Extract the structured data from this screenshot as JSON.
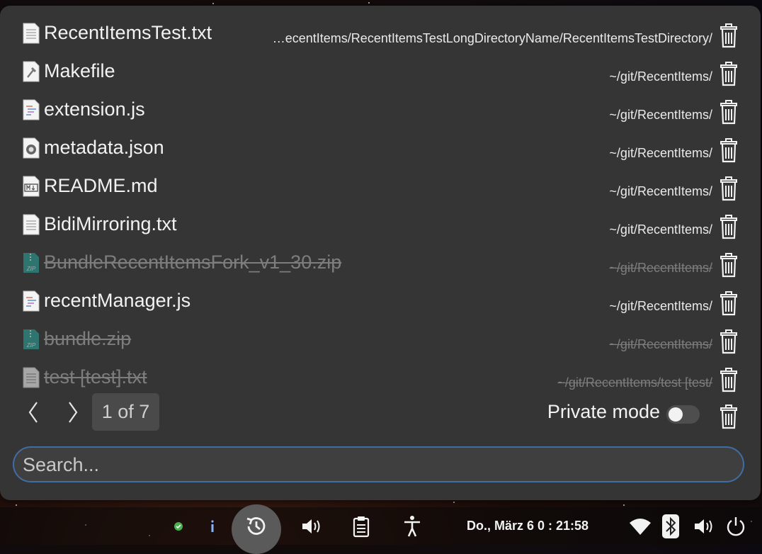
{
  "recent_items": [
    {
      "name": "RecentItemsTest.txt",
      "path": "…ecentItems/RecentItemsTestLongDirectoryName/RecentItemsTestDirectory/",
      "icon": "text-file-icon",
      "missing": false
    },
    {
      "name": "Makefile",
      "path": "~/git/RecentItems/",
      "icon": "makefile-icon",
      "missing": false
    },
    {
      "name": "extension.js",
      "path": "~/git/RecentItems/",
      "icon": "script-file-icon",
      "missing": false
    },
    {
      "name": "metadata.json",
      "path": "~/git/RecentItems/",
      "icon": "json-file-icon",
      "missing": false
    },
    {
      "name": "README.md",
      "path": "~/git/RecentItems/",
      "icon": "markdown-file-icon",
      "missing": false
    },
    {
      "name": "BidiMirroring.txt",
      "path": "~/git/RecentItems/",
      "icon": "text-file-icon",
      "missing": false
    },
    {
      "name": "BundleRecentItemsFork_v1_30.zip",
      "path": "~/git/RecentItems/",
      "icon": "zip-file-icon",
      "missing": true
    },
    {
      "name": "recentManager.js",
      "path": "~/git/RecentItems/",
      "icon": "script-file-icon",
      "missing": false
    },
    {
      "name": "bundle.zip",
      "path": "~/git/RecentItems/",
      "icon": "zip-file-icon",
      "missing": true
    },
    {
      "name": "test [test].txt",
      "path": "~/git/RecentItems/test [test/",
      "icon": "text-file-icon",
      "missing": true
    }
  ],
  "pagination": {
    "label": "1 of 7"
  },
  "private_mode": {
    "label": "Private mode",
    "enabled": false
  },
  "search": {
    "placeholder": "Search..."
  },
  "panel": {
    "clock": "Do., März 6  0 : 21:58"
  },
  "colors": {
    "popup_bg": "#353535",
    "accent": "#3d6ea8",
    "missing_text": "#7d7d7d"
  }
}
